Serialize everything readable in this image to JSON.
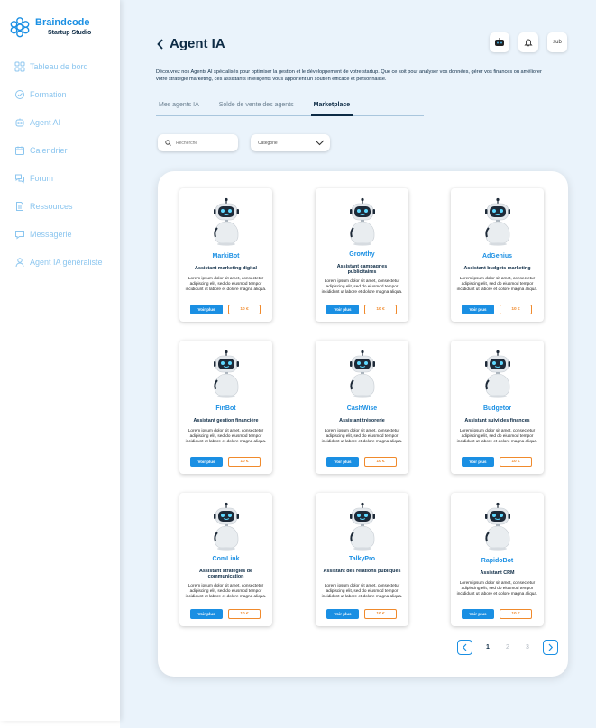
{
  "brand": {
    "name": "Braindcode",
    "subtitle": "Startup Studio"
  },
  "sidebar": {
    "items": [
      {
        "label": "Tableau de bord",
        "icon": "dashboard-icon"
      },
      {
        "label": "Formation",
        "icon": "formation-icon"
      },
      {
        "label": "Agent AI",
        "icon": "agent-icon"
      },
      {
        "label": "Calendrier",
        "icon": "calendar-icon"
      },
      {
        "label": "Forum",
        "icon": "forum-icon"
      },
      {
        "label": "Ressources",
        "icon": "resources-icon"
      },
      {
        "label": "Messagerie",
        "icon": "messaging-icon"
      },
      {
        "label": "Agent IA généraliste",
        "icon": "general-agent-icon"
      }
    ]
  },
  "header": {
    "title": "Agent IA",
    "lang": "sub"
  },
  "description": "Découvrez nos Agents AI spécialisés pour optimiser la gestion et le développement de votre startup. Que ce soit pour analyser vos données, gérer vos finances ou améliorer votre stratégie marketing, ces assistants intelligents vous apportent un soutien efficace et personnalisé.",
  "tabs": [
    {
      "label": "Mes agents IA",
      "active": false
    },
    {
      "label": "Solde de vente des agents",
      "active": false
    },
    {
      "label": "Marketplace",
      "active": true
    }
  ],
  "search": {
    "placeholder": "Recherche"
  },
  "category": {
    "label": "Catégorie"
  },
  "agents": [
    {
      "name": "MarkiBot",
      "role": "Assistant marketing digital",
      "desc": "Lorem ipsum dolor sit amet, consectetur adipiscing elit, sed do eiusmod tempor incididunt ut labore et dolore magna aliqua.",
      "button": "Voir plus",
      "price": "10 €"
    },
    {
      "name": "Growthy",
      "role": "Assistant campagnes publicitaires",
      "desc": "Lorem ipsum dolor sit amet, consectetur adipiscing elit, sed do eiusmod tempor incididunt ut labore et dolore magna aliqua.",
      "button": "Voir plus",
      "price": "10 €"
    },
    {
      "name": "AdGenius",
      "role": "Assistant budgets marketing",
      "desc": "Lorem ipsum dolor sit amet, consectetur adipiscing elit, sed do eiusmod tempor incididunt ut labore et dolore magna aliqua.",
      "button": "Voir plus",
      "price": "10 €"
    },
    {
      "name": "FinBot",
      "role": "Assistant gestion financière",
      "desc": "Lorem ipsum dolor sit amet, consectetur adipiscing elit, sed do eiusmod tempor incididunt ut labore et dolore magna aliqua.",
      "button": "Voir plus",
      "price": "10 €"
    },
    {
      "name": "CashWise",
      "role": "Assistant trésorerie",
      "desc": "Lorem ipsum dolor sit amet, consectetur adipiscing elit, sed do eiusmod tempor incididunt ut labore et dolore magna aliqua.",
      "button": "Voir plus",
      "price": "10 €"
    },
    {
      "name": "Budgetor",
      "role": "Assistant suivi des finances",
      "desc": "Lorem ipsum dolor sit amet, consectetur adipiscing elit, sed do eiusmod tempor incididunt ut labore et dolore magna aliqua.",
      "button": "Voir plus",
      "price": "10 €"
    },
    {
      "name": "ComLink",
      "role": "Assistant stratégies de communication",
      "desc": "Lorem ipsum dolor sit amet, consectetur adipiscing elit, sed do eiusmod tempor incididunt ut labore et dolore magna aliqua.",
      "button": "Voir plus",
      "price": "10 €"
    },
    {
      "name": "TalkyPro",
      "role": "Assistant des relations publiques",
      "desc": "Lorem ipsum dolor sit amet, consectetur adipiscing elit, sed do eiusmod tempor incididunt ut labore et dolore magna aliqua.",
      "button": "Voir plus",
      "price": "10 €"
    },
    {
      "name": "RapidoBot",
      "role": "Assistant CRM",
      "desc": "Lorem ipsum dolor sit amet, consectetur adipiscing elit, sed do eiusmod tempor incididunt ut labore et dolore magna aliqua.",
      "button": "Voir plus",
      "price": "10 €"
    }
  ],
  "pagination": {
    "pages": [
      "1",
      "2",
      "3"
    ],
    "current": "1"
  },
  "colors": {
    "accent": "#1a8fe3",
    "navy": "#0d2b45",
    "price": "#f08a2c",
    "sidebar_text": "#8cc6ef",
    "background": "#eaf3fb"
  }
}
